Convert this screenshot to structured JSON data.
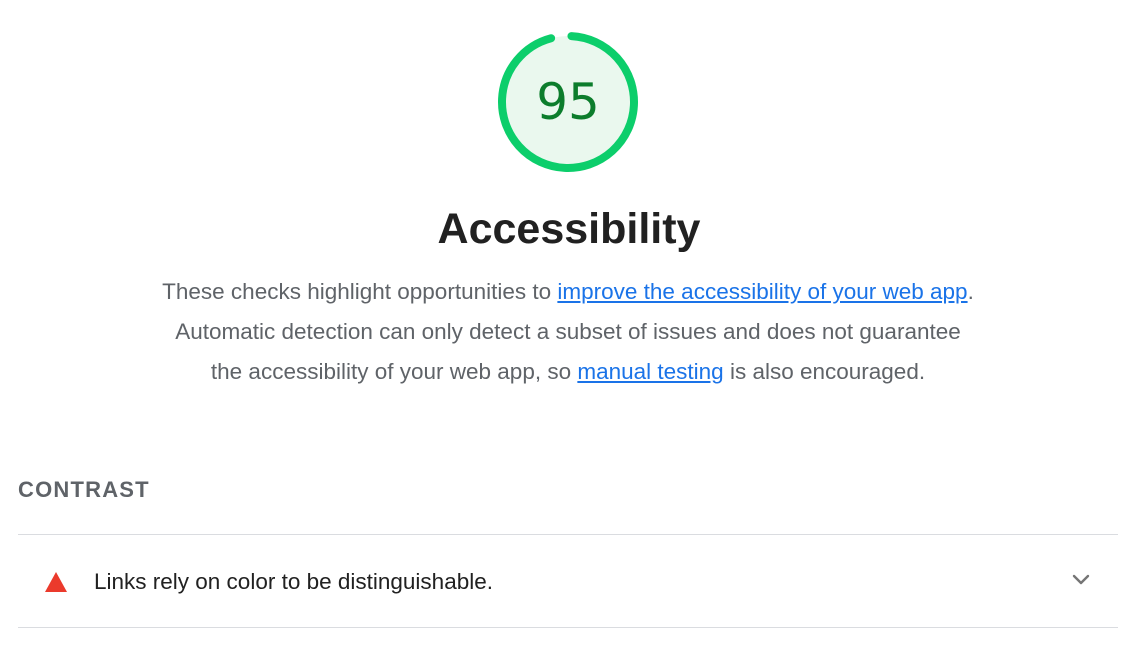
{
  "gauge": {
    "score": "95",
    "fraction": 0.95,
    "color": "#0cce6b",
    "fill_color": "#eaf8ee",
    "text_color": "#0c7d2c"
  },
  "category": {
    "title": "Accessibility"
  },
  "description": {
    "text_1": "These checks highlight opportunities to ",
    "link_1": "improve the accessibility of your web app",
    "text_2": ". Automatic detection can only detect a subset of issues and does not guarantee the accessibility of your web app, so ",
    "link_2": "manual testing",
    "text_3": " is also encouraged."
  },
  "group": {
    "title": "CONTRAST"
  },
  "audits": [
    {
      "title": "Links rely on color to be distinguishable.",
      "status_icon": "fail-triangle-icon",
      "status_color": "#eb3a2c",
      "expand_icon": "chevron-down-icon"
    }
  ]
}
